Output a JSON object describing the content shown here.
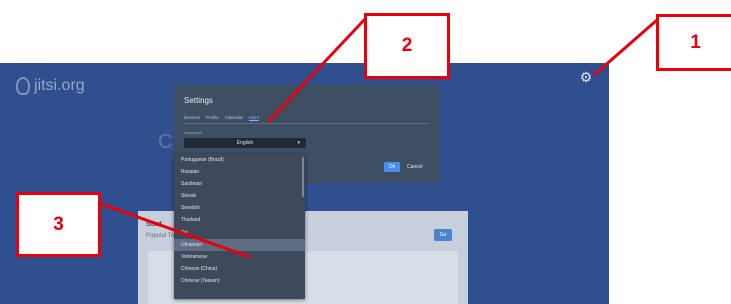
{
  "app": {
    "logo_text": "jitsi.org",
    "settings_icon": "gear-icon"
  },
  "background": {
    "heading_left": "C",
    "heading_right": "l",
    "card_title": "Start",
    "card_sub": "Populat Tod",
    "card_button": "Go"
  },
  "dialog": {
    "title": "Settings",
    "tabs": [
      {
        "label": "Devices"
      },
      {
        "label": "Profile"
      },
      {
        "label": "Calendar"
      },
      {
        "label": "More"
      }
    ],
    "language_label": "Language",
    "selected_language": "English",
    "ok_label": "Ok",
    "cancel_label": "Cancel"
  },
  "dropdown": {
    "items": [
      {
        "label": "Portuguese (Brazil)"
      },
      {
        "label": "Russian"
      },
      {
        "label": "Sardinian"
      },
      {
        "label": "Slovak"
      },
      {
        "label": "Swedish"
      },
      {
        "label": "Thailand"
      },
      {
        "label": "Tel"
      },
      {
        "label": "Ukrainian"
      },
      {
        "label": "Vietnamese"
      },
      {
        "label": "Chinese (China)"
      },
      {
        "label": "Chinese (Taiwan)"
      }
    ],
    "highlighted_index": 7
  },
  "callouts": [
    {
      "label": "1"
    },
    {
      "label": "2"
    },
    {
      "label": "3"
    }
  ],
  "colors": {
    "callout": "#e8000b",
    "app_background": "#2f4f8f",
    "accent": "#4a8df0"
  }
}
